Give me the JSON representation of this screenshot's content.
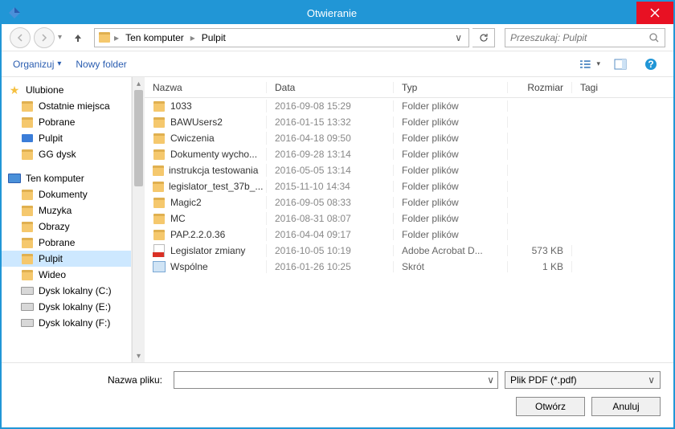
{
  "title": "Otwieranie",
  "breadcrumb": {
    "l1": "Ten komputer",
    "l2": "Pulpit"
  },
  "search": {
    "placeholder": "Przeszukaj: Pulpit"
  },
  "toolbar": {
    "organize": "Organizuj",
    "new_folder": "Nowy folder"
  },
  "columns": {
    "name": "Nazwa",
    "date": "Data",
    "type": "Typ",
    "size": "Rozmiar",
    "tags": "Tagi"
  },
  "sidebar": {
    "favorites_label": "Ulubione",
    "favorites": [
      {
        "label": "Ostatnie miejsca",
        "icon": "folder"
      },
      {
        "label": "Pobrane",
        "icon": "folder"
      },
      {
        "label": "Pulpit",
        "icon": "desk"
      },
      {
        "label": "GG dysk",
        "icon": "folder"
      }
    ],
    "computer_label": "Ten komputer",
    "computer": [
      {
        "label": "Dokumenty",
        "icon": "folder"
      },
      {
        "label": "Muzyka",
        "icon": "folder"
      },
      {
        "label": "Obrazy",
        "icon": "folder"
      },
      {
        "label": "Pobrane",
        "icon": "folder"
      },
      {
        "label": "Pulpit",
        "icon": "folder",
        "selected": true
      },
      {
        "label": "Wideo",
        "icon": "folder"
      },
      {
        "label": "Dysk lokalny (C:)",
        "icon": "drive"
      },
      {
        "label": "Dysk lokalny (E:)",
        "icon": "drive"
      },
      {
        "label": "Dysk lokalny (F:)",
        "icon": "drive"
      }
    ]
  },
  "files": [
    {
      "name": "1033",
      "date": "2016-09-08 15:29",
      "type": "Folder plików",
      "size": "",
      "icon": "folder"
    },
    {
      "name": "BAWUsers2",
      "date": "2016-01-15 13:32",
      "type": "Folder plików",
      "size": "",
      "icon": "folder"
    },
    {
      "name": "Cwiczenia",
      "date": "2016-04-18 09:50",
      "type": "Folder plików",
      "size": "",
      "icon": "folder"
    },
    {
      "name": "Dokumenty wycho...",
      "date": "2016-09-28 13:14",
      "type": "Folder plików",
      "size": "",
      "icon": "folder"
    },
    {
      "name": "instrukcja testowania",
      "date": "2016-05-05 13:14",
      "type": "Folder plików",
      "size": "",
      "icon": "folder"
    },
    {
      "name": "legislator_test_37b_...",
      "date": "2015-11-10 14:34",
      "type": "Folder plików",
      "size": "",
      "icon": "folder"
    },
    {
      "name": "Magic2",
      "date": "2016-09-05 08:33",
      "type": "Folder plików",
      "size": "",
      "icon": "folder"
    },
    {
      "name": "MC",
      "date": "2016-08-31 08:07",
      "type": "Folder plików",
      "size": "",
      "icon": "folder"
    },
    {
      "name": "PAP.2.2.0.36",
      "date": "2016-04-04 09:17",
      "type": "Folder plików",
      "size": "",
      "icon": "folder"
    },
    {
      "name": "Legislator zmiany",
      "date": "2016-10-05 10:19",
      "type": "Adobe Acrobat D...",
      "size": "573 KB",
      "icon": "pdf"
    },
    {
      "name": "Wspólne",
      "date": "2016-01-26 10:25",
      "type": "Skrót",
      "size": "1 KB",
      "icon": "shortcut"
    }
  ],
  "footer": {
    "filename_label": "Nazwa pliku:",
    "filter": "Plik PDF (*.pdf)",
    "open": "Otwórz",
    "cancel": "Anuluj"
  }
}
